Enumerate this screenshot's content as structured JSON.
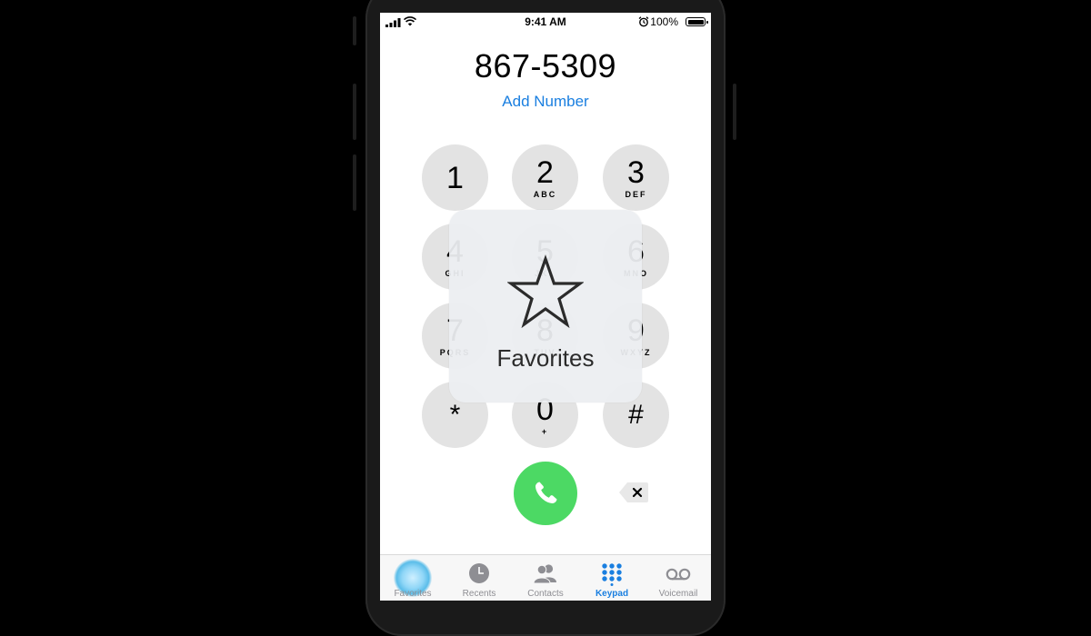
{
  "status_bar": {
    "time": "9:41 AM",
    "battery_percent": "100%",
    "battery_level": 1.0
  },
  "dialer": {
    "number": "867-5309",
    "add_number_label": "Add Number"
  },
  "keypad": [
    {
      "digit": "1",
      "letters": ""
    },
    {
      "digit": "2",
      "letters": "ABC"
    },
    {
      "digit": "3",
      "letters": "DEF"
    },
    {
      "digit": "4",
      "letters": "GHI"
    },
    {
      "digit": "5",
      "letters": "JKL"
    },
    {
      "digit": "6",
      "letters": "MNO"
    },
    {
      "digit": "7",
      "letters": "PQRS"
    },
    {
      "digit": "8",
      "letters": "TUV"
    },
    {
      "digit": "9",
      "letters": "WXYZ"
    },
    {
      "digit": "*",
      "letters": ""
    },
    {
      "digit": "0",
      "letters": "+"
    },
    {
      "digit": "#",
      "letters": ""
    }
  ],
  "overlay": {
    "icon": "star-icon",
    "label": "Favorites"
  },
  "actions": {
    "call_icon": "phone-icon",
    "delete_icon": "delete-backspace-icon",
    "call_color": "#4cd964"
  },
  "tabs": [
    {
      "label": "Favorites",
      "icon": "star-icon",
      "active": false
    },
    {
      "label": "Recents",
      "icon": "clock-icon",
      "active": false
    },
    {
      "label": "Contacts",
      "icon": "contacts-icon",
      "active": false
    },
    {
      "label": "Keypad",
      "icon": "keypad-icon",
      "active": true
    },
    {
      "label": "Voicemail",
      "icon": "voicemail-icon",
      "active": false
    }
  ],
  "colors": {
    "accent": "#1a7fe0",
    "key_bg": "#e3e3e3",
    "inactive_tab": "#8e8e93"
  }
}
